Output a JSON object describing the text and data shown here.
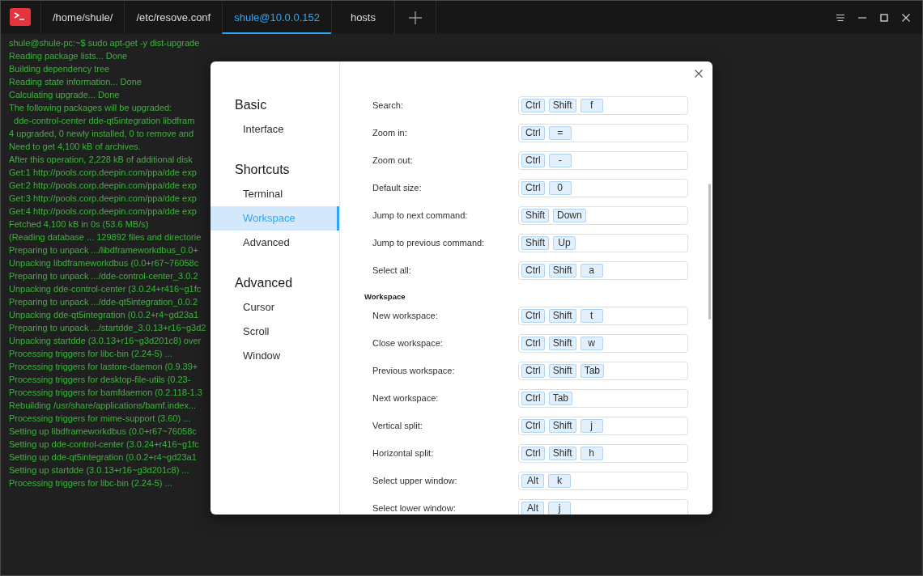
{
  "window": {
    "tabs": [
      {
        "label": "/home/shule/",
        "selected": false
      },
      {
        "label": "/etc/resove.conf",
        "selected": false
      },
      {
        "label": "shule@10.0.0.152",
        "selected": true
      },
      {
        "label": "hosts",
        "selected": false
      }
    ]
  },
  "terminal": {
    "lines": [
      "shule@shule-pc:~$ sudo apt-get -y dist-upgrade",
      "Reading package lists... Done",
      "Building dependency tree",
      "Reading state information... Done",
      "Calculating upgrade... Done",
      "The following packages will be upgraded:",
      "  dde-control-center dde-qt5integration libdfram",
      "4 upgraded, 0 newly installed, 0 to remove and",
      "Need to get 4,100 kB of archives.",
      "After this operation, 2,228 kB of additional disk",
      "Get:1 http://pools.corp.deepin.com/ppa/dde exp",
      "Get:2 http://pools.corp.deepin.com/ppa/dde exp",
      "Get:3 http://pools.corp.deepin.com/ppa/dde exp",
      "Get:4 http://pools.corp.deepin.com/ppa/dde exp",
      "Fetched 4,100 kB in 0s (53.6 MB/s)",
      "(Reading database ... 129892 files and directorie",
      "Preparing to unpack .../libdframeworkdbus_0.0+",
      "Unpacking libdframeworkdbus (0.0+r67~76058c",
      "Preparing to unpack .../dde-control-center_3.0.2",
      "Unpacking dde-control-center (3.0.24+r416~g1fc",
      "Preparing to unpack .../dde-qt5integration_0.0.2",
      "Unpacking dde-qt5integration (0.0.2+r4~gd23a1",
      "Preparing to unpack .../startdde_3.0.13+r16~g3d2",
      "Unpacking startdde (3.0.13+r16~g3d201c8) over",
      "Processing triggers for libc-bin (2.24-5) ...",
      "Processing triggers for lastore-daemon (0.9.39+",
      "Processing triggers for desktop-file-utils (0.23-",
      "Processing triggers for bamfdaemon (0.2.118-1.3",
      "Rebuilding /usr/share/applications/bamf.index...",
      "Processing triggers for mime-support (3.60) ...",
      "Setting up libdframeworkdbus (0.0+r67~76058c",
      "Setting up dde-control-center (3.0.24+r416~g1fc",
      "Setting up dde-qt5integration (0.0.2+r4~gd23a1",
      "Setting up startdde (3.0.13+r16~g3d201c8) ...",
      "Processing triggers for libc-bin (2.24-5) ..."
    ]
  },
  "settings_dialog": {
    "nav": [
      {
        "heading": "Basic",
        "items": [
          {
            "label": "Interface",
            "selected": false
          }
        ]
      },
      {
        "heading": "Shortcuts",
        "items": [
          {
            "label": "Terminal",
            "selected": false
          },
          {
            "label": "Workspace",
            "selected": true
          },
          {
            "label": "Advanced",
            "selected": false
          }
        ]
      },
      {
        "heading": "Advanced",
        "items": [
          {
            "label": "Cursor",
            "selected": false
          },
          {
            "label": "Scroll",
            "selected": false
          },
          {
            "label": "Window",
            "selected": false
          }
        ]
      }
    ],
    "sections": [
      {
        "rows": [
          {
            "label": "Search:",
            "keys": [
              "Ctrl",
              "Shift",
              "f"
            ]
          },
          {
            "label": "Zoom in:",
            "keys": [
              "Ctrl",
              "="
            ]
          },
          {
            "label": "Zoom out:",
            "keys": [
              "Ctrl",
              "-"
            ]
          },
          {
            "label": "Default size:",
            "keys": [
              "Ctrl",
              "0"
            ]
          },
          {
            "label": "Jump to next command:",
            "keys": [
              "Shift",
              "Down"
            ]
          },
          {
            "label": "Jump to previous command:",
            "keys": [
              "Shift",
              "Up"
            ]
          },
          {
            "label": "Select all:",
            "keys": [
              "Ctrl",
              "Shift",
              "a"
            ]
          }
        ]
      },
      {
        "heading": "Workspace",
        "rows": [
          {
            "label": "New workspace:",
            "keys": [
              "Ctrl",
              "Shift",
              "t"
            ]
          },
          {
            "label": "Close workspace:",
            "keys": [
              "Ctrl",
              "Shift",
              "w"
            ]
          },
          {
            "label": "Previous workspace:",
            "keys": [
              "Ctrl",
              "Shift",
              "Tab"
            ]
          },
          {
            "label": "Next workspace:",
            "keys": [
              "Ctrl",
              "Tab"
            ]
          },
          {
            "label": "Vertical split:",
            "keys": [
              "Ctrl",
              "Shift",
              "j"
            ]
          },
          {
            "label": "Horizontal split:",
            "keys": [
              "Ctrl",
              "Shift",
              "h"
            ]
          },
          {
            "label": "Select upper window:",
            "keys": [
              "Alt",
              "k"
            ]
          },
          {
            "label": "Select lower window:",
            "keys": [
              "Alt",
              "j"
            ]
          }
        ]
      }
    ]
  }
}
